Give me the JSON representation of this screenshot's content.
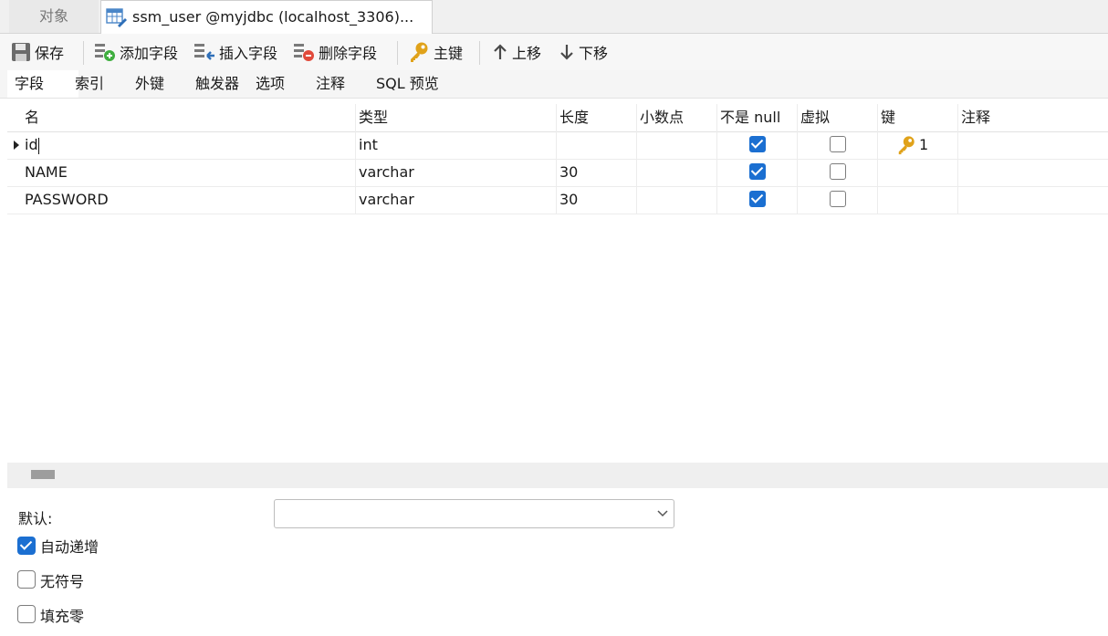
{
  "doc_tabs": {
    "objects": "对象",
    "active": "ssm_user @myjdbc (localhost_3306)..."
  },
  "toolbar": {
    "save": "保存",
    "add_field": "添加字段",
    "insert_field": "插入字段",
    "delete_field": "删除字段",
    "primary_key": "主键",
    "move_up": "上移",
    "move_down": "下移"
  },
  "subtabs": [
    "字段",
    "索引",
    "外键",
    "触发器",
    "选项",
    "注释",
    "SQL 预览"
  ],
  "grid": {
    "headers": {
      "name": "名",
      "type": "类型",
      "length": "长度",
      "decimals": "小数点",
      "not_null": "不是 null",
      "virtual": "虚拟",
      "key": "键",
      "comment": "注释"
    },
    "rows": [
      {
        "name": "id",
        "type": "int",
        "length": "",
        "decimals": "",
        "not_null": true,
        "virtual": false,
        "key": "1",
        "comment": ""
      },
      {
        "name": "NAME",
        "type": "varchar",
        "length": "30",
        "decimals": "",
        "not_null": true,
        "virtual": false,
        "key": "",
        "comment": ""
      },
      {
        "name": "PASSWORD",
        "type": "varchar",
        "length": "30",
        "decimals": "",
        "not_null": true,
        "virtual": false,
        "key": "",
        "comment": ""
      }
    ]
  },
  "props": {
    "default_label": "默认:",
    "default_value": "",
    "auto_increment": {
      "label": "自动递增",
      "checked": true
    },
    "unsigned": {
      "label": "无符号",
      "checked": false
    },
    "zerofill": {
      "label": "填充零",
      "checked": false
    }
  },
  "colors": {
    "accent": "#1b6fd1",
    "key_gold": "#e0a21a",
    "add_green": "#3fae3f",
    "delete_red": "#e14a3b"
  }
}
